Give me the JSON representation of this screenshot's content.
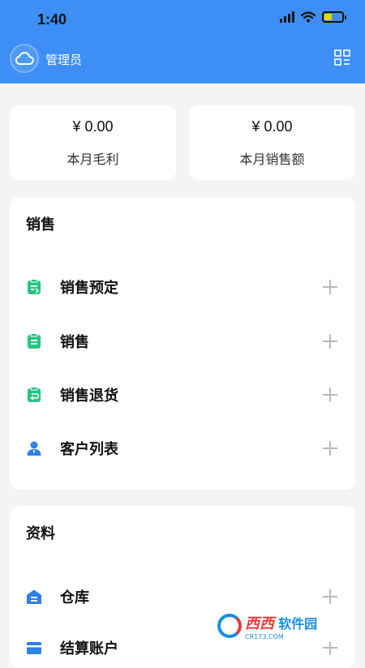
{
  "status_bar": {
    "time": "1:40"
  },
  "nav": {
    "title": "管理员",
    "menu_icon": "grid-menu-icon"
  },
  "summary": [
    {
      "value": "¥ 0.00",
      "label": "本月毛利"
    },
    {
      "value": "¥ 0.00",
      "label": "本月销售额"
    }
  ],
  "sales_section": {
    "title": "销售",
    "items": [
      {
        "label": "销售预定",
        "icon": "sales-order-icon"
      },
      {
        "label": "销售",
        "icon": "sales-icon"
      },
      {
        "label": "销售退货",
        "icon": "sales-return-icon"
      },
      {
        "label": "客户列表",
        "icon": "customer-list-icon"
      }
    ]
  },
  "data_section": {
    "title": "资料",
    "items": [
      {
        "label": "仓库",
        "icon": "warehouse-icon"
      },
      {
        "label": "结算账户",
        "icon": "account-icon"
      }
    ]
  },
  "colors": {
    "header": "#3d8ff5",
    "green_icon": "#27c482",
    "blue_icon": "#2f7fe8",
    "plus": "#b9b9b9"
  },
  "watermark": {
    "text_a": "西西",
    "text_b": "软件园",
    "sub": "CR173.COM"
  }
}
